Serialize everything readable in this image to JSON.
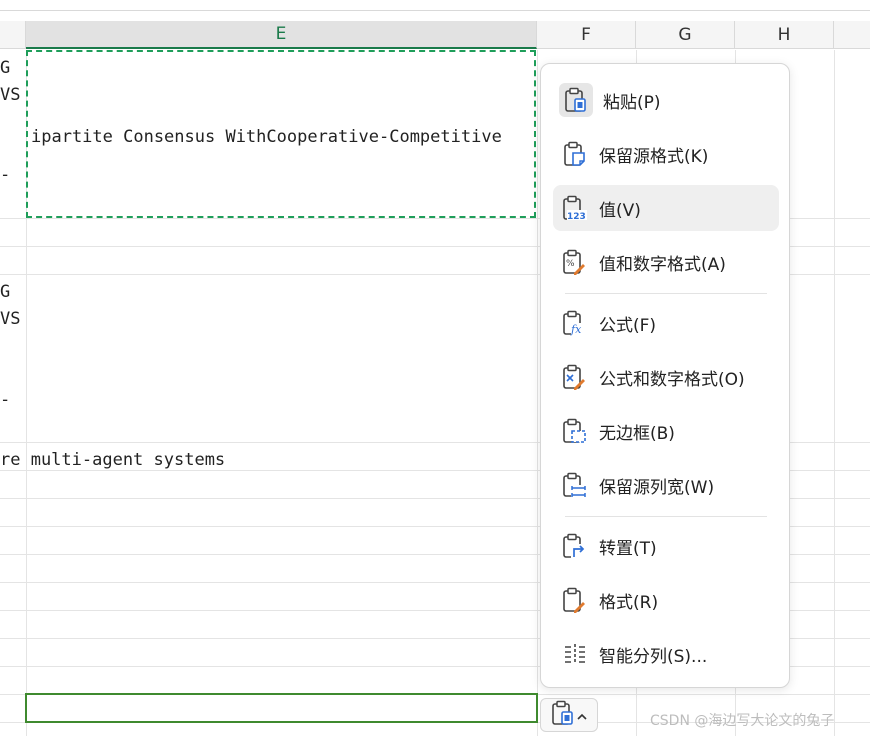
{
  "columns": {
    "e": "E",
    "f": "F",
    "g": "G",
    "h": "H"
  },
  "cells": {
    "row_a_fragment_1": "G",
    "row_a_fragment_2": "VS",
    "row_a_fragment_3": "-",
    "row_a_main": "ipartite Consensus WithCooperative-Competitive",
    "row_b_fragment_1": "G",
    "row_b_fragment_2": "VS",
    "row_b_fragment_3": "-",
    "row_c_main": "re multi-agent systems"
  },
  "context_menu": {
    "items": [
      {
        "label": "粘贴(P)",
        "icon": "paste-icon"
      },
      {
        "label": "保留源格式(K)",
        "icon": "keep-source-format-icon"
      },
      {
        "label": "值(V)",
        "icon": "paste-values-icon"
      },
      {
        "label": "值和数字格式(A)",
        "icon": "values-number-format-icon"
      },
      {
        "label": "公式(F)",
        "icon": "paste-formula-icon"
      },
      {
        "label": "公式和数字格式(O)",
        "icon": "formula-number-format-icon"
      },
      {
        "label": "无边框(B)",
        "icon": "no-border-icon"
      },
      {
        "label": "保留源列宽(W)",
        "icon": "keep-column-width-icon"
      },
      {
        "label": "转置(T)",
        "icon": "transpose-icon"
      },
      {
        "label": "格式(R)",
        "icon": "paste-format-icon"
      },
      {
        "label": "智能分列(S)...",
        "icon": "smart-split-icon"
      }
    ],
    "highlighted": "值(V)"
  },
  "paste_options_button": {
    "icon": "paste-icon",
    "caret": "chevron-up-icon"
  },
  "watermark": "CSDN @海边写大论文的兔子",
  "colors": {
    "accent": "#1a7a4a",
    "copy_border": "#1f9e5a",
    "active_cell_border": "#3f8a2f",
    "icon_blue": "#2f6fd6",
    "icon_orange": "#e07a2e"
  }
}
